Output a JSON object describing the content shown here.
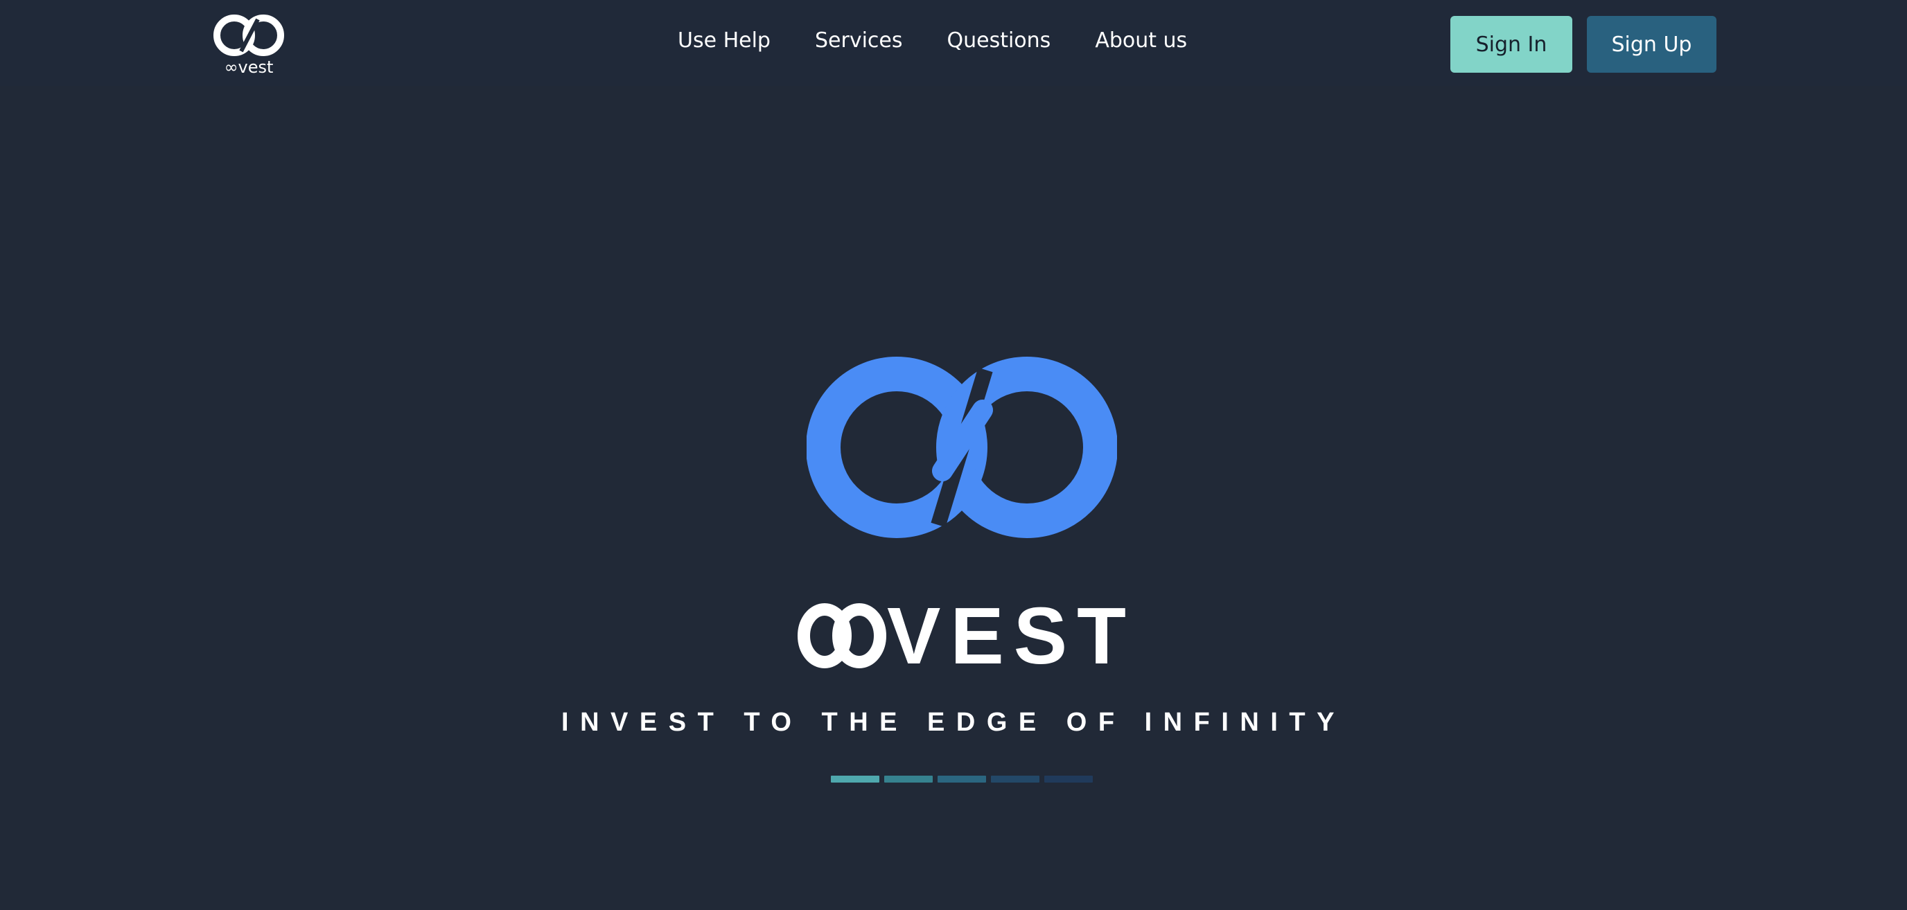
{
  "header": {
    "logo_word": "∞vest",
    "nav": [
      {
        "label": "Use Help"
      },
      {
        "label": "Services"
      },
      {
        "label": "Questions"
      },
      {
        "label": "About us"
      }
    ],
    "sign_in_label": "Sign In",
    "sign_up_label": "Sign Up"
  },
  "hero": {
    "brand_text": "VEST",
    "tagline": "INVEST TO THE EDGE OF INFINITY",
    "loader_segments": 5
  },
  "colors": {
    "background": "#212937",
    "accent_blue": "#4a8cf5",
    "sign_in": "#82d4c8",
    "sign_up": "#29617f",
    "loader": [
      "#4fa8ad",
      "#36828f",
      "#2b6680",
      "#234868",
      "#203a5b"
    ]
  },
  "icons": {
    "logo": "infinity-logo-icon",
    "hero": "infinity-mark-icon"
  }
}
